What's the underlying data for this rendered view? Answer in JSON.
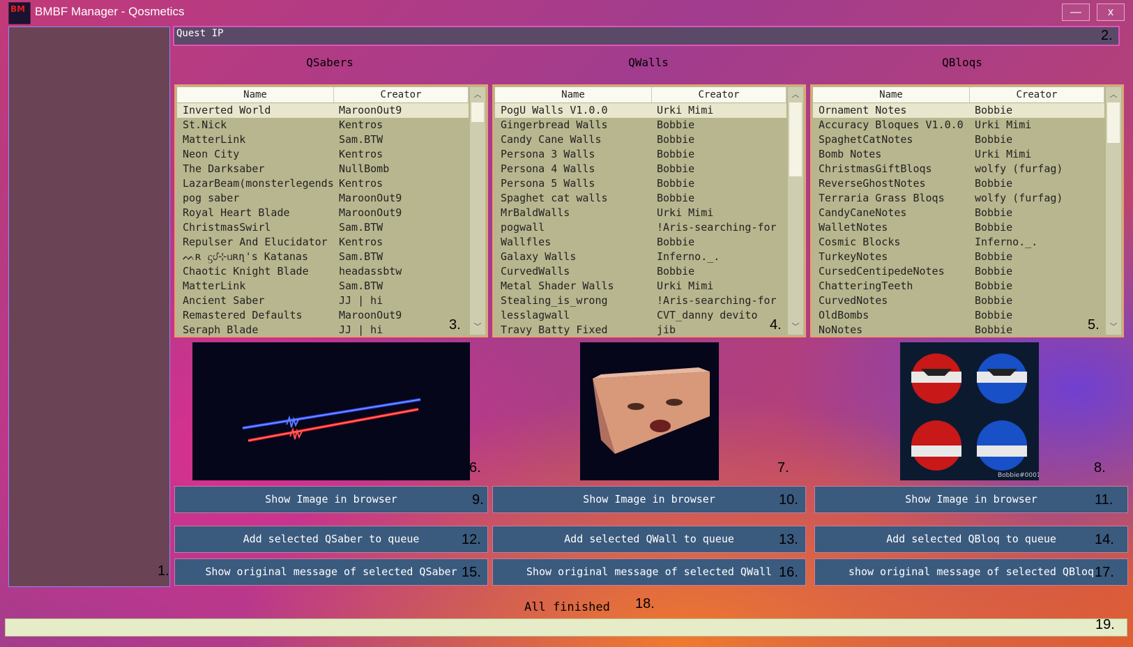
{
  "window": {
    "title": "BMBF Manager - Qosmetics",
    "icon_text": "BM",
    "minimize_label": "—",
    "close_label": "x"
  },
  "annotations": [
    "1.",
    "2.",
    "3.",
    "4.",
    "5.",
    "6.",
    "7.",
    "8.",
    "9.",
    "10.",
    "11.",
    "12.",
    "13.",
    "14.",
    "15.",
    "16.",
    "17.",
    "18.",
    "19."
  ],
  "quest_ip": {
    "value": "Quest IP"
  },
  "columns": {
    "name_header": "Name",
    "creator_header": "Creator"
  },
  "qsabers": {
    "title": "QSabers",
    "rows": [
      [
        "Inverted World",
        "MaroonOut9"
      ],
      [
        "St.Nick",
        "Kentros"
      ],
      [
        "MatterLink",
        "Sam.BTW"
      ],
      [
        "Neon City",
        "Kentros"
      ],
      [
        "The Darksaber",
        "NullBomb"
      ],
      [
        "LazarBeam(monsterlegends",
        "Kentros"
      ],
      [
        "pog saber",
        "MaroonOut9"
      ],
      [
        "Royal Heart Blade",
        "MaroonOut9"
      ],
      [
        "ChristmasSwirl",
        "Sam.BTW"
      ],
      [
        "Repulser And Elucidator",
        "Kentros"
      ],
      [
        "ᨓʀ ᦓᦔ⊹ᥙʀɳ's Katanas",
        "Sam.BTW"
      ],
      [
        "Chaotic Knight Blade",
        "headassbtw"
      ],
      [
        "MatterLink",
        "Sam.BTW"
      ],
      [
        "Ancient Saber",
        "JJ | hi"
      ],
      [
        "Remastered Defaults",
        "MaroonOut9"
      ],
      [
        "Seraph Blade",
        "JJ | hi"
      ]
    ],
    "show_image_label": "Show Image in browser",
    "add_label": "Add selected QSaber to queue",
    "original_label": "Show original message of selected QSaber"
  },
  "qwalls": {
    "title": "QWalls",
    "rows": [
      [
        "PogU Walls V1.0.0",
        "Urki Mimi"
      ],
      [
        "Gingerbread Walls",
        "Bobbie"
      ],
      [
        "Candy Cane Walls",
        "Bobbie"
      ],
      [
        "Persona 3 Walls",
        "Bobbie"
      ],
      [
        "Persona 4 Walls",
        "Bobbie"
      ],
      [
        "Persona 5 Walls",
        "Bobbie"
      ],
      [
        "Spaghet cat walls",
        "Bobbie"
      ],
      [
        "MrBaldWalls",
        "Urki Mimi"
      ],
      [
        "pogwall",
        "!Aris-searching-for"
      ],
      [
        "Wallfles",
        "Bobbie"
      ],
      [
        "Galaxy Walls",
        "Inferno._."
      ],
      [
        "CurvedWalls",
        "Bobbie"
      ],
      [
        "Metal Shader Walls",
        "Urki Mimi"
      ],
      [
        "Stealing_is_wrong",
        "!Aris-searching-for"
      ],
      [
        "lesslagwall",
        "CVT_danny devito"
      ],
      [
        "Travy Batty Fixed",
        "jib"
      ]
    ],
    "show_image_label": "Show Image in browser",
    "add_label": "Add selected QWall to queue",
    "original_label": "Show original message of selected QWall"
  },
  "qbloqs": {
    "title": "QBloqs",
    "rows": [
      [
        "Ornament Notes",
        "Bobbie"
      ],
      [
        "Accuracy Bloques V1.0.0",
        "Urki Mimi"
      ],
      [
        "SpaghetCatNotes",
        "Bobbie"
      ],
      [
        "Bomb Notes",
        "Urki Mimi"
      ],
      [
        "ChristmasGiftBloqs",
        "wolfy (furfag)"
      ],
      [
        "ReverseGhostNotes",
        "Bobbie"
      ],
      [
        "Terraria Grass Bloqs",
        "wolfy (furfag)"
      ],
      [
        "CandyCaneNotes",
        "Bobbie"
      ],
      [
        "WalletNotes",
        "Bobbie"
      ],
      [
        "Cosmic Blocks",
        "Inferno._."
      ],
      [
        "TurkeyNotes",
        "Bobbie"
      ],
      [
        "CursedCentipedeNotes",
        "Bobbie"
      ],
      [
        "ChatteringTeeth",
        "Bobbie"
      ],
      [
        "CurvedNotes",
        "Bobbie"
      ],
      [
        "OldBombs",
        "Bobbie"
      ],
      [
        "NoNotes",
        "Bobbie"
      ]
    ],
    "show_image_label": "Show Image in browser",
    "add_label": "Add selected QBloq to queue",
    "original_label": "show original message of selected QBloq",
    "preview_watermark": "Bobbie#0001"
  },
  "status": {
    "text": "All finished",
    "progress": 0.0
  },
  "colors": {
    "list_bg": "#b8b68e",
    "button_bg": "#3a5a7e",
    "progress_fill": "#c6dc50"
  }
}
